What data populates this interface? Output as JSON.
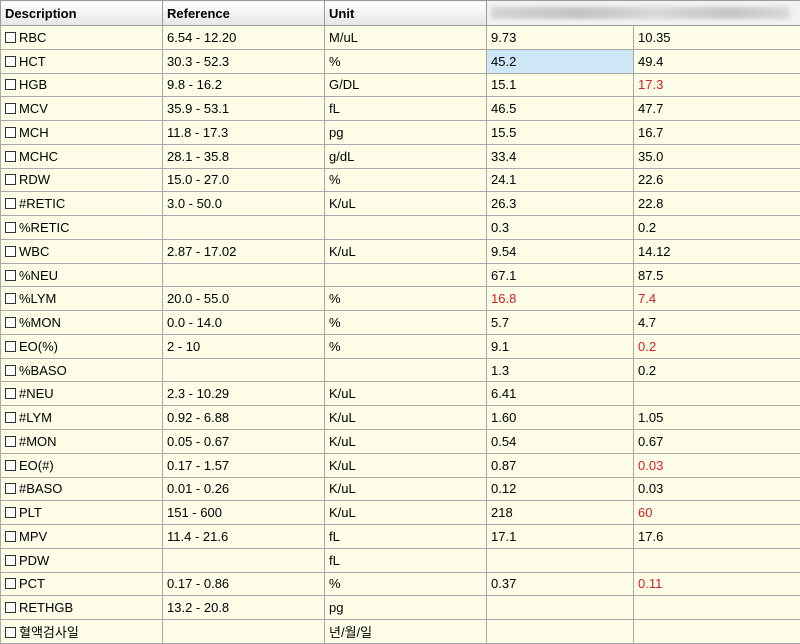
{
  "headers": [
    "Description",
    "Reference",
    "Unit",
    "",
    ""
  ],
  "colors": {
    "abnormal": "#cc2222",
    "selected_cell": "#cfe6f7",
    "meta_background": "#fdfde8"
  },
  "selected": {
    "row": 1,
    "col": 1
  },
  "rows": [
    {
      "desc": "RBC",
      "ref": "6.54 - 12.20",
      "unit": "M/uL",
      "v1": "9.73",
      "v2": "10.35"
    },
    {
      "desc": "HCT",
      "ref": "30.3 - 52.3",
      "unit": "%",
      "v1": "45.2",
      "v2": "49.4"
    },
    {
      "desc": "HGB",
      "ref": "9.8 - 16.2",
      "unit": "G/DL",
      "v1": "15.1",
      "v2": "17.3",
      "flag2": true
    },
    {
      "desc": "MCV",
      "ref": "35.9 - 53.1",
      "unit": "fL",
      "v1": "46.5",
      "v2": "47.7"
    },
    {
      "desc": "MCH",
      "ref": "11.8 - 17.3",
      "unit": "pg",
      "v1": "15.5",
      "v2": "16.7"
    },
    {
      "desc": "MCHC",
      "ref": "28.1 - 35.8",
      "unit": "g/dL",
      "v1": "33.4",
      "v2": "35.0"
    },
    {
      "desc": "RDW",
      "ref": "15.0 - 27.0",
      "unit": "%",
      "v1": "24.1",
      "v2": "22.6"
    },
    {
      "desc": "#RETIC",
      "ref": "3.0 - 50.0",
      "unit": "K/uL",
      "v1": "26.3",
      "v2": "22.8"
    },
    {
      "desc": "%RETIC",
      "ref": "",
      "unit": "",
      "v1": "0.3",
      "v2": "0.2"
    },
    {
      "desc": "WBC",
      "ref": "2.87 - 17.02",
      "unit": "K/uL",
      "v1": "9.54",
      "v2": "14.12"
    },
    {
      "desc": "%NEU",
      "ref": "",
      "unit": "",
      "v1": "67.1",
      "v2": "87.5"
    },
    {
      "desc": "%LYM",
      "ref": "20.0 - 55.0",
      "unit": "%",
      "v1": "16.8",
      "v2": "7.4",
      "flag1": true,
      "flag2": true
    },
    {
      "desc": "%MON",
      "ref": "0.0 - 14.0",
      "unit": "%",
      "v1": "5.7",
      "v2": "4.7"
    },
    {
      "desc": "EO(%)",
      "ref": "2 - 10",
      "unit": "%",
      "v1": "9.1",
      "v2": "0.2",
      "flag2": true
    },
    {
      "desc": "%BASO",
      "ref": "",
      "unit": "",
      "v1": "1.3",
      "v2": "0.2"
    },
    {
      "desc": "#NEU",
      "ref": "2.3 - 10.29",
      "unit": "K/uL",
      "v1": "6.41",
      "v2": ""
    },
    {
      "desc": "#LYM",
      "ref": "0.92 - 6.88",
      "unit": "K/uL",
      "v1": "1.60",
      "v2": "1.05"
    },
    {
      "desc": "#MON",
      "ref": "0.05 - 0.67",
      "unit": "K/uL",
      "v1": "0.54",
      "v2": "0.67"
    },
    {
      "desc": "EO(#)",
      "ref": "0.17 - 1.57",
      "unit": "K/uL",
      "v1": "0.87",
      "v2": "0.03",
      "flag2": true
    },
    {
      "desc": "#BASO",
      "ref": "0.01 - 0.26",
      "unit": "K/uL",
      "v1": "0.12",
      "v2": "0.03"
    },
    {
      "desc": "PLT",
      "ref": "151 - 600",
      "unit": "K/uL",
      "v1": "218",
      "v2": "60",
      "flag2": true
    },
    {
      "desc": "MPV",
      "ref": "11.4 - 21.6",
      "unit": "fL",
      "v1": "17.1",
      "v2": "17.6"
    },
    {
      "desc": "PDW",
      "ref": "",
      "unit": "fL",
      "v1": "",
      "v2": ""
    },
    {
      "desc": "PCT",
      "ref": "0.17 - 0.86",
      "unit": "%",
      "v1": "0.37",
      "v2": "0.11",
      "flag2": true
    },
    {
      "desc": "RETHGB",
      "ref": "13.2 - 20.8",
      "unit": "pg",
      "v1": "",
      "v2": ""
    },
    {
      "desc": "혈액검사일",
      "ref": "",
      "unit": "년/월/일",
      "v1": "",
      "v2": ""
    }
  ]
}
